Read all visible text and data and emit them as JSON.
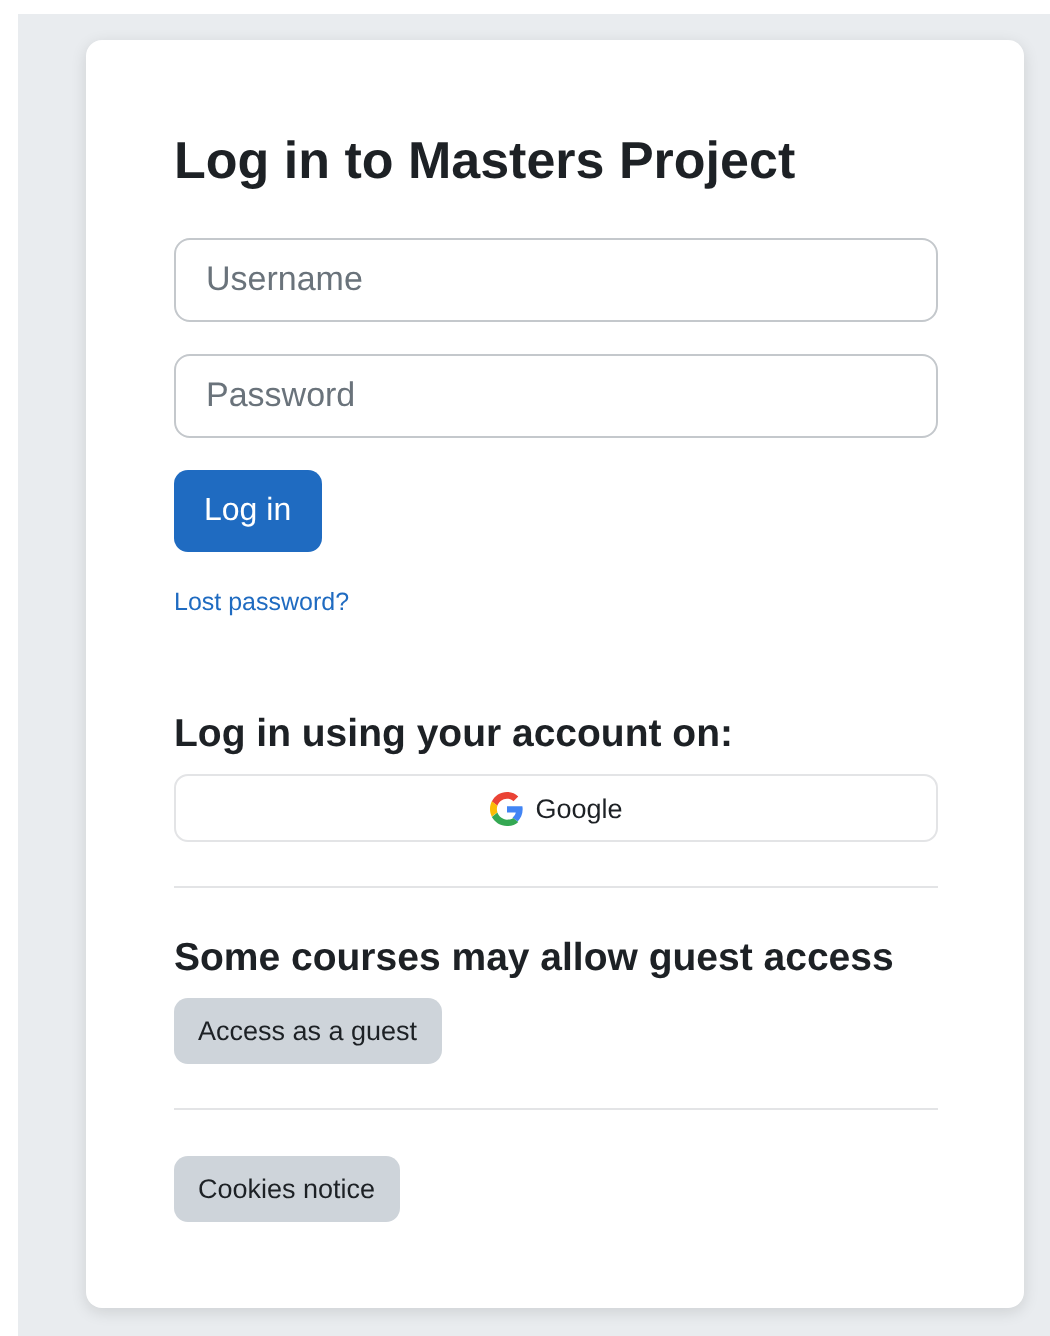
{
  "title": "Log in to Masters Project",
  "fields": [
    {
      "placeholder": "Username"
    },
    {
      "placeholder": "Password"
    }
  ],
  "login_button": "Log in",
  "lost_password_link": "Lost password?",
  "sections": [
    {
      "kind": "providers",
      "heading": "Log in using your account on:",
      "buttons": [
        "Google"
      ]
    },
    {
      "kind": "guest",
      "heading": "Some courses may allow guest access",
      "buttons": [
        "Access as a guest"
      ]
    },
    {
      "kind": "plain",
      "buttons": [
        "Cookies notice"
      ]
    }
  ]
}
